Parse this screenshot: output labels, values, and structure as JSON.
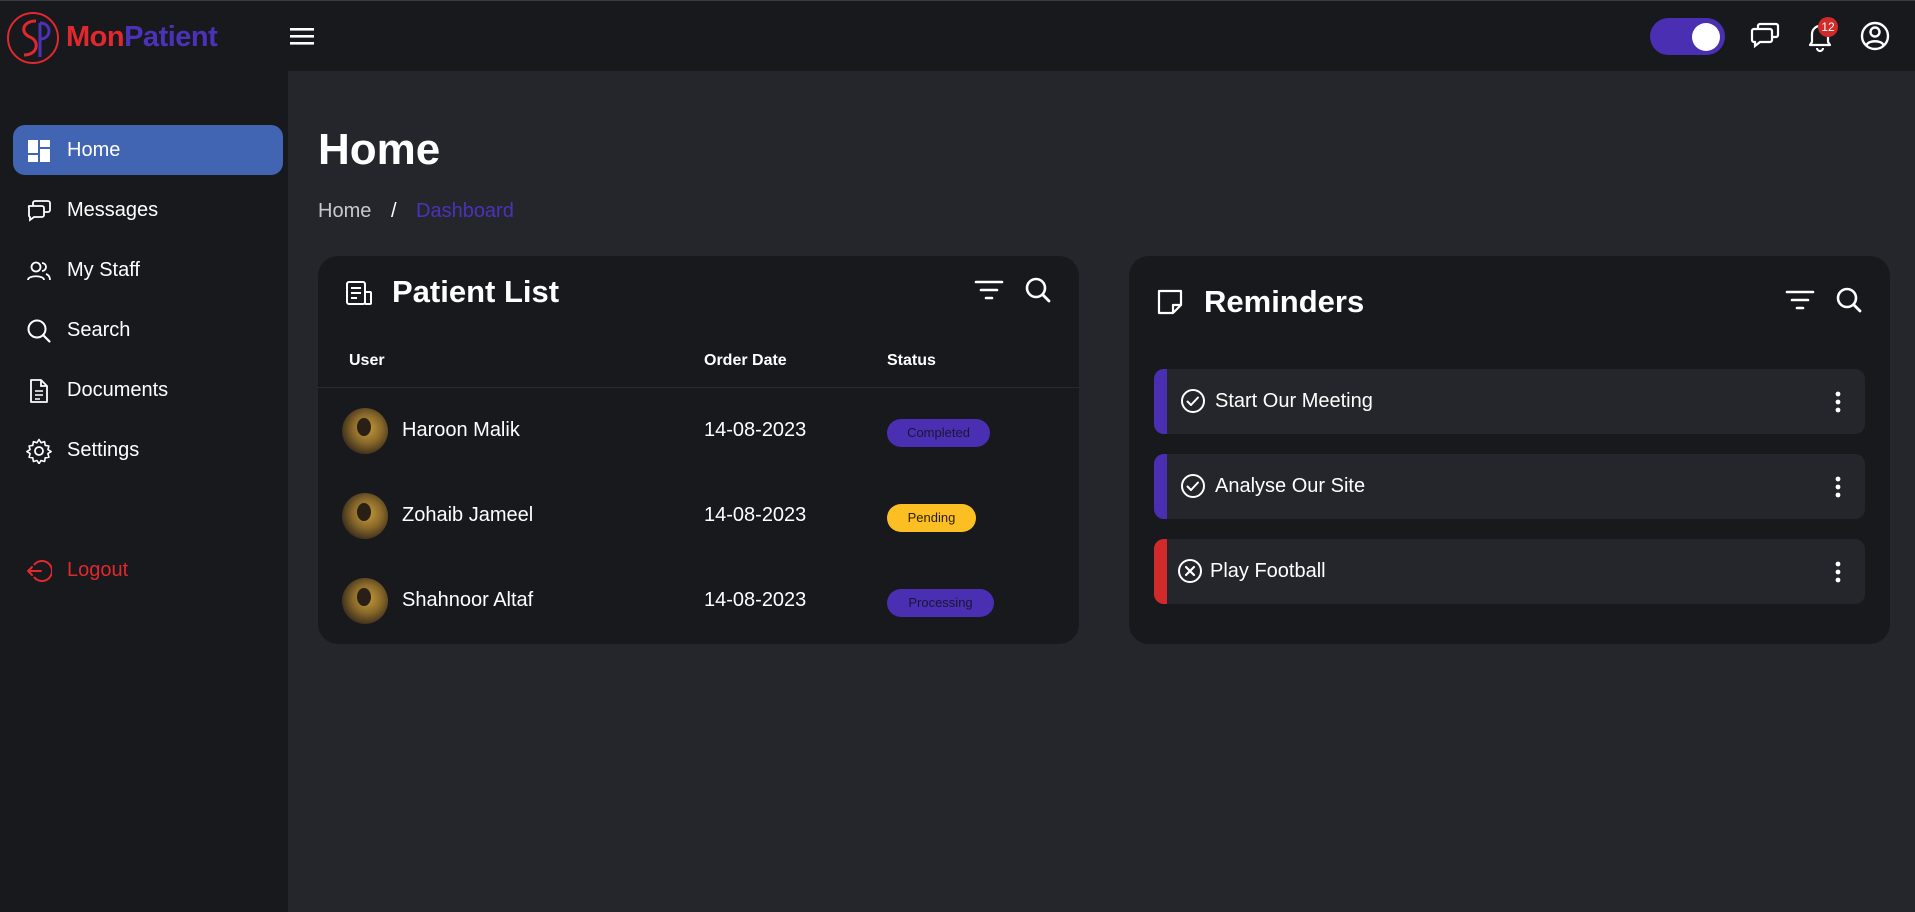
{
  "brand": {
    "part1": "Mon",
    "part2": "Patient"
  },
  "header": {
    "notification_count": "12"
  },
  "sidebar": {
    "items": [
      {
        "label": "Home",
        "icon": "dashboard-icon"
      },
      {
        "label": "Messages",
        "icon": "chat-icon"
      },
      {
        "label": "My Staff",
        "icon": "people-icon"
      },
      {
        "label": "Search",
        "icon": "search-icon"
      },
      {
        "label": "Documents",
        "icon": "document-icon"
      },
      {
        "label": "Settings",
        "icon": "gear-icon"
      }
    ],
    "logout_label": "Logout"
  },
  "page": {
    "title": "Home",
    "breadcrumb": {
      "first": "Home",
      "separator": "/",
      "current": "Dashboard"
    }
  },
  "patients": {
    "title": "Patient List",
    "columns": {
      "user": "User",
      "date": "Order Date",
      "status": "Status"
    },
    "rows": [
      {
        "name": "Haroon Malik",
        "date": "14-08-2023",
        "status": "Completed"
      },
      {
        "name": "Zohaib Jameel",
        "date": "14-08-2023",
        "status": "Pending"
      },
      {
        "name": "Shahnoor Altaf",
        "date": "14-08-2023",
        "status": "Processing"
      }
    ]
  },
  "reminders": {
    "title": "Reminders",
    "items": [
      {
        "label": "Start Our Meeting",
        "state": "done"
      },
      {
        "label": "Analyse Our Site",
        "state": "done"
      },
      {
        "label": "Play Football",
        "state": "cancelled"
      }
    ]
  },
  "colors": {
    "accent_purple": "#4a2fb3",
    "active_nav": "#4164b3",
    "danger_red": "#e0282e",
    "pending_yellow": "#fbbf24"
  }
}
